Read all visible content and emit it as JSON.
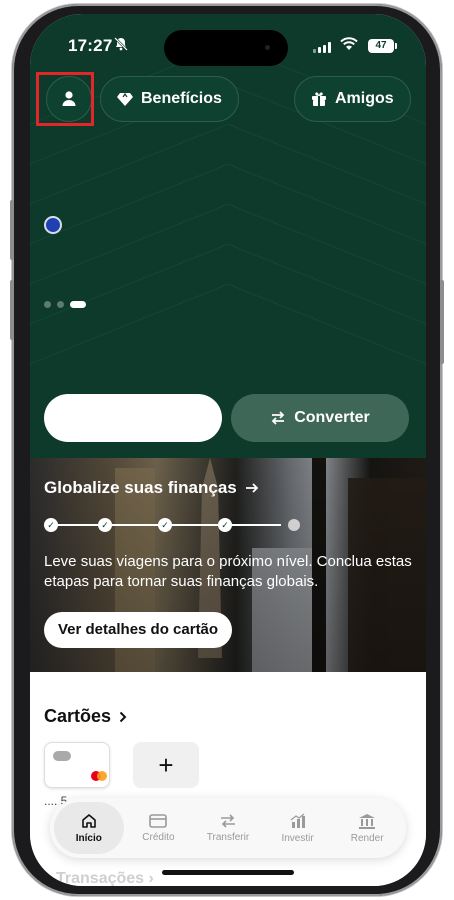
{
  "status_bar": {
    "time": "17:27",
    "battery": "47"
  },
  "header": {
    "profile_icon": "person-icon",
    "benefits_label": "Benefícios",
    "benefits_icon": "diamond-icon",
    "friends_label": "Amigos",
    "friends_icon": "gift-icon"
  },
  "hero": {
    "convert_label": "Converter",
    "convert_icon": "swap-arrows-icon",
    "page_count": 3,
    "active_page": 3
  },
  "banner": {
    "title": "Globalize suas finanças",
    "text": "Leve suas viagens para o próximo nível. Conclua estas etapas para tornar suas finanças globais.",
    "button_label": "Ver detalhes do cartão",
    "steps_total": 5,
    "steps_completed": 4
  },
  "cards": {
    "title": "Cartões",
    "card_label": ".... 5",
    "add_icon": "plus-icon"
  },
  "transactions": {
    "title": "Transações"
  },
  "tabbar": {
    "items": [
      {
        "label": "Início",
        "icon": "home-icon",
        "active": true
      },
      {
        "label": "Crédito",
        "icon": "credit-card-icon",
        "active": false
      },
      {
        "label": "Transferir",
        "icon": "transfer-icon",
        "active": false
      },
      {
        "label": "Investir",
        "icon": "chart-icon",
        "active": false
      },
      {
        "label": "Render",
        "icon": "bank-icon",
        "active": false
      }
    ]
  },
  "colors": {
    "primary_green": "#0d3a2b",
    "button_green": "#3f6757",
    "highlight_red": "#e3262a",
    "accent_blue": "#1f3fb3"
  }
}
